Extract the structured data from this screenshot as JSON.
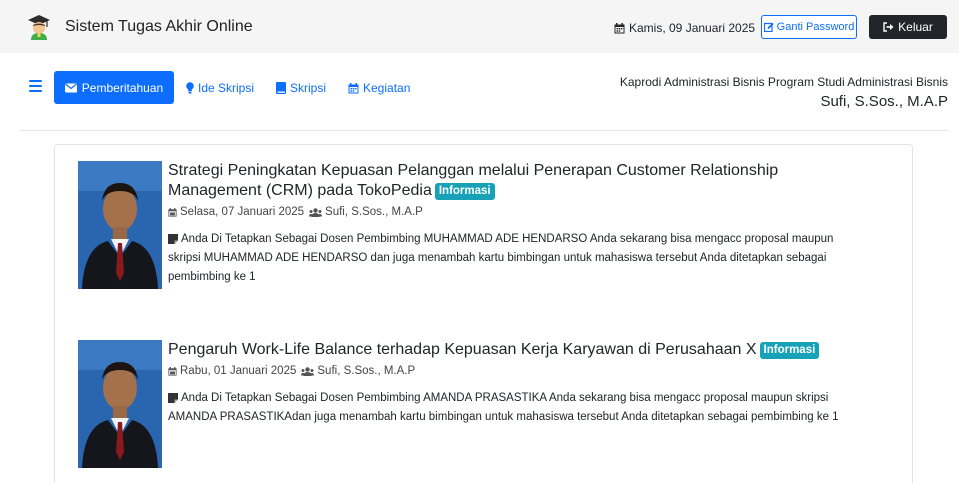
{
  "header": {
    "app_title": "Sistem Tugas Akhir Online",
    "date": "Kamis, 09 Januari 2025",
    "change_password_label": "Ganti Password",
    "logout_label": "Keluar"
  },
  "nav": {
    "items": [
      {
        "label": "Pemberitahuan",
        "icon": "envelope-icon",
        "active": true
      },
      {
        "label": "Ide Skripsi",
        "icon": "lightbulb-icon",
        "active": false
      },
      {
        "label": "Skripsi",
        "icon": "book-icon",
        "active": false
      },
      {
        "label": "Kegiatan",
        "icon": "calendar-icon",
        "active": false
      }
    ]
  },
  "user": {
    "role": "Kaprodi Administrasi Bisnis Program Studi Administrasi Bisnis",
    "name": "Sufi, S.Sos., M.A.P"
  },
  "notifications": [
    {
      "title": "Strategi Peningkatan Kepuasan Pelanggan melalui Penerapan Customer Relationship Management (CRM) pada TokoPedia",
      "badge": "Informasi",
      "date": "Selasa, 07 Januari 2025",
      "author": "Sufi, S.Sos., M.A.P",
      "description": "Anda Di Tetapkan Sebagai Dosen Pembimbing MUHAMMAD ADE HENDARSO Anda sekarang bisa mengacc proposal maupun skripsi MUHAMMAD ADE HENDARSO dan juga menambah kartu bimbingan untuk mahasiswa tersebut Anda ditetapkan sebagai pembimbing ke 1"
    },
    {
      "title": "Pengaruh Work-Life Balance terhadap Kepuasan Kerja Karyawan di Perusahaan X",
      "badge": "Informasi",
      "date": "Rabu, 01 Januari 2025",
      "author": "Sufi, S.Sos., M.A.P",
      "description": "Anda Di Tetapkan Sebagai Dosen Pembimbing AMANDA PRASASTIKA Anda sekarang bisa mengacc proposal maupun skripsi AMANDA PRASASTIKAdan juga menambah kartu bimbingan untuk mahasiswa tersebut Anda ditetapkan sebagai pembimbing ke 1"
    }
  ],
  "colors": {
    "primary": "#0d6efd",
    "dark": "#212529",
    "badge": "#17a2b8",
    "topbar_bg": "#f5f5f5"
  }
}
